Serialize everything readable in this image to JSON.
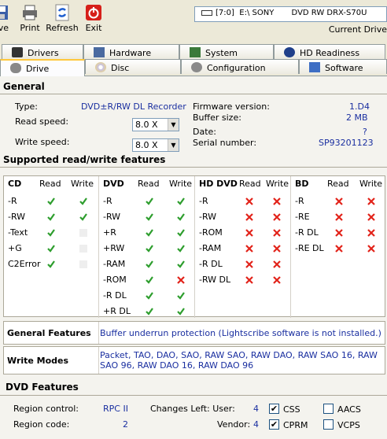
{
  "toolbar": {
    "save_label": "ave",
    "print_label": "Print",
    "refresh_label": "Refresh",
    "exit_label": "Exit"
  },
  "drive_selector": {
    "value": "[7:0]  E:\\ SONY       DVD RW DRX-S70U",
    "current_label": "Current Drive"
  },
  "tabs_top": [
    "Drivers",
    "Hardware",
    "System",
    "HD Readiness"
  ],
  "tabs_bottom": [
    "Drive",
    "Disc",
    "Configuration",
    "Software"
  ],
  "general": {
    "title": "General",
    "type_label": "Type:",
    "type_value": "DVD±R/RW DL Recorder",
    "read_speed_label": "Read speed:",
    "read_speed_value": "8.0 X",
    "write_speed_label": "Write speed:",
    "write_speed_value": "8.0 X",
    "firmware_label": "Firmware version:",
    "firmware_value": "1.D4",
    "buffer_label": "Buffer size:",
    "buffer_value": "2 MB",
    "date_label": "Date:",
    "date_value": "?",
    "serial_label": "Serial number:",
    "serial_value": "SP93201123"
  },
  "features": {
    "title": "Supported read/write features",
    "read_header": "Read",
    "write_header": "Write",
    "cd": {
      "title": "CD",
      "rows": [
        {
          "name": "-R",
          "read": "check",
          "write": "check"
        },
        {
          "name": "-RW",
          "read": "check",
          "write": "check"
        },
        {
          "name": "-Text",
          "read": "check",
          "write": "dim"
        },
        {
          "name": "+G",
          "read": "check",
          "write": "dim"
        },
        {
          "name": "C2Error",
          "read": "check",
          "write": "dim"
        }
      ]
    },
    "dvd": {
      "title": "DVD",
      "rows": [
        {
          "name": "-R",
          "read": "check",
          "write": "check"
        },
        {
          "name": "-RW",
          "read": "check",
          "write": "check"
        },
        {
          "name": "+R",
          "read": "check",
          "write": "check"
        },
        {
          "name": "+RW",
          "read": "check",
          "write": "check"
        },
        {
          "name": "-RAM",
          "read": "check",
          "write": "check"
        },
        {
          "name": "-ROM",
          "read": "check",
          "write": "cross"
        },
        {
          "name": "-R DL",
          "read": "check",
          "write": "check"
        },
        {
          "name": "+R DL",
          "read": "check",
          "write": "check"
        }
      ]
    },
    "hddvd": {
      "title": "HD DVD",
      "rows": [
        {
          "name": "-R",
          "read": "cross",
          "write": "cross"
        },
        {
          "name": "-RW",
          "read": "cross",
          "write": "cross"
        },
        {
          "name": "-ROM",
          "read": "cross",
          "write": "cross"
        },
        {
          "name": "-RAM",
          "read": "cross",
          "write": "cross"
        },
        {
          "name": "-R DL",
          "read": "cross",
          "write": "cross"
        },
        {
          "name": "-RW DL",
          "read": "cross",
          "write": "cross"
        }
      ]
    },
    "bd": {
      "title": "BD",
      "rows": [
        {
          "name": "-R",
          "read": "cross",
          "write": "cross"
        },
        {
          "name": "-RE",
          "read": "cross",
          "write": "cross"
        },
        {
          "name": "-R DL",
          "read": "cross",
          "write": "cross"
        },
        {
          "name": "-RE DL",
          "read": "cross",
          "write": "cross"
        }
      ]
    }
  },
  "general_features": {
    "label": "General Features",
    "value": "Buffer underrun protection (Lightscribe software is not installed.)"
  },
  "write_modes": {
    "label": "Write Modes",
    "value_line1": "Packet, TAO, DAO, SAO, RAW SAO, RAW DAO, RAW SAO 16, RAW",
    "value_line2": "SAO 96, RAW DAO 16, RAW DAO 96"
  },
  "dvd_features": {
    "title": "DVD Features",
    "region_control_label": "Region control:",
    "region_control_value": "RPC II",
    "region_code_label": "Region code:",
    "region_code_value": "2",
    "changes_left_label": "Changes Left: User:",
    "changes_left_user_value": "4",
    "vendor_label": "Vendor:",
    "vendor_value": "4",
    "css_label": "CSS",
    "css_checked": true,
    "cprm_label": "CPRM",
    "cprm_checked": true,
    "aacs_label": "AACS",
    "aacs_checked": false,
    "vcps_label": "VCPS",
    "vcps_checked": false
  },
  "colors": {
    "value_blue": "#1a2fa0",
    "check_green": "#2e9e2e",
    "cross_red": "#e2231a"
  }
}
